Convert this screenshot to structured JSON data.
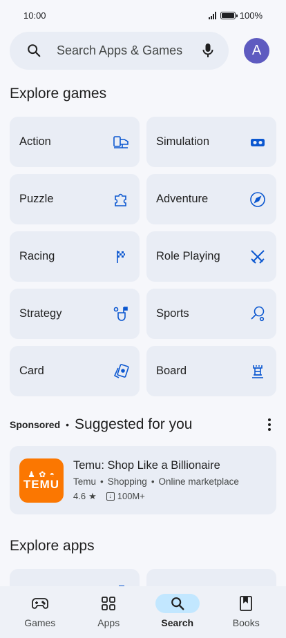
{
  "status_bar": {
    "time": "10:00",
    "battery": "100%",
    "battery_level": 1.0
  },
  "search": {
    "placeholder": "Search Apps & Games",
    "avatar_letter": "A"
  },
  "explore_games": {
    "title": "Explore games",
    "categories": [
      {
        "label": "Action",
        "icon": "action-icon"
      },
      {
        "label": "Simulation",
        "icon": "simulation-icon"
      },
      {
        "label": "Puzzle",
        "icon": "puzzle-icon"
      },
      {
        "label": "Adventure",
        "icon": "compass-icon"
      },
      {
        "label": "Racing",
        "icon": "checkered-flag-icon"
      },
      {
        "label": "Role Playing",
        "icon": "crossed-swords-icon"
      },
      {
        "label": "Strategy",
        "icon": "strategy-icon"
      },
      {
        "label": "Sports",
        "icon": "sports-icon"
      },
      {
        "label": "Card",
        "icon": "cards-icon"
      },
      {
        "label": "Board",
        "icon": "chess-rook-icon"
      }
    ]
  },
  "suggested": {
    "sponsored_label": "Sponsored",
    "separator": "•",
    "title": "Suggested for you",
    "app": {
      "name": "Temu: Shop Like a Billionaire",
      "developer": "Temu",
      "category": "Shopping",
      "tag": "Online marketplace",
      "meta_separator": "•",
      "rating": "4.6",
      "star": "★",
      "downloads": "100M+",
      "logo_text": "TEMU",
      "logo_color": "#fb7701"
    }
  },
  "explore_apps": {
    "title": "Explore apps"
  },
  "bottom_nav": {
    "items": [
      {
        "label": "Games",
        "icon": "gamepad-icon",
        "active": false
      },
      {
        "label": "Apps",
        "icon": "apps-grid-icon",
        "active": false
      },
      {
        "label": "Search",
        "icon": "search-icon",
        "active": true
      },
      {
        "label": "Books",
        "icon": "book-icon",
        "active": false
      }
    ]
  },
  "colors": {
    "accent": "#0b57d0",
    "active_pill": "#c2e7ff",
    "card": "#e9edf5",
    "avatar": "#5e5bc0"
  }
}
